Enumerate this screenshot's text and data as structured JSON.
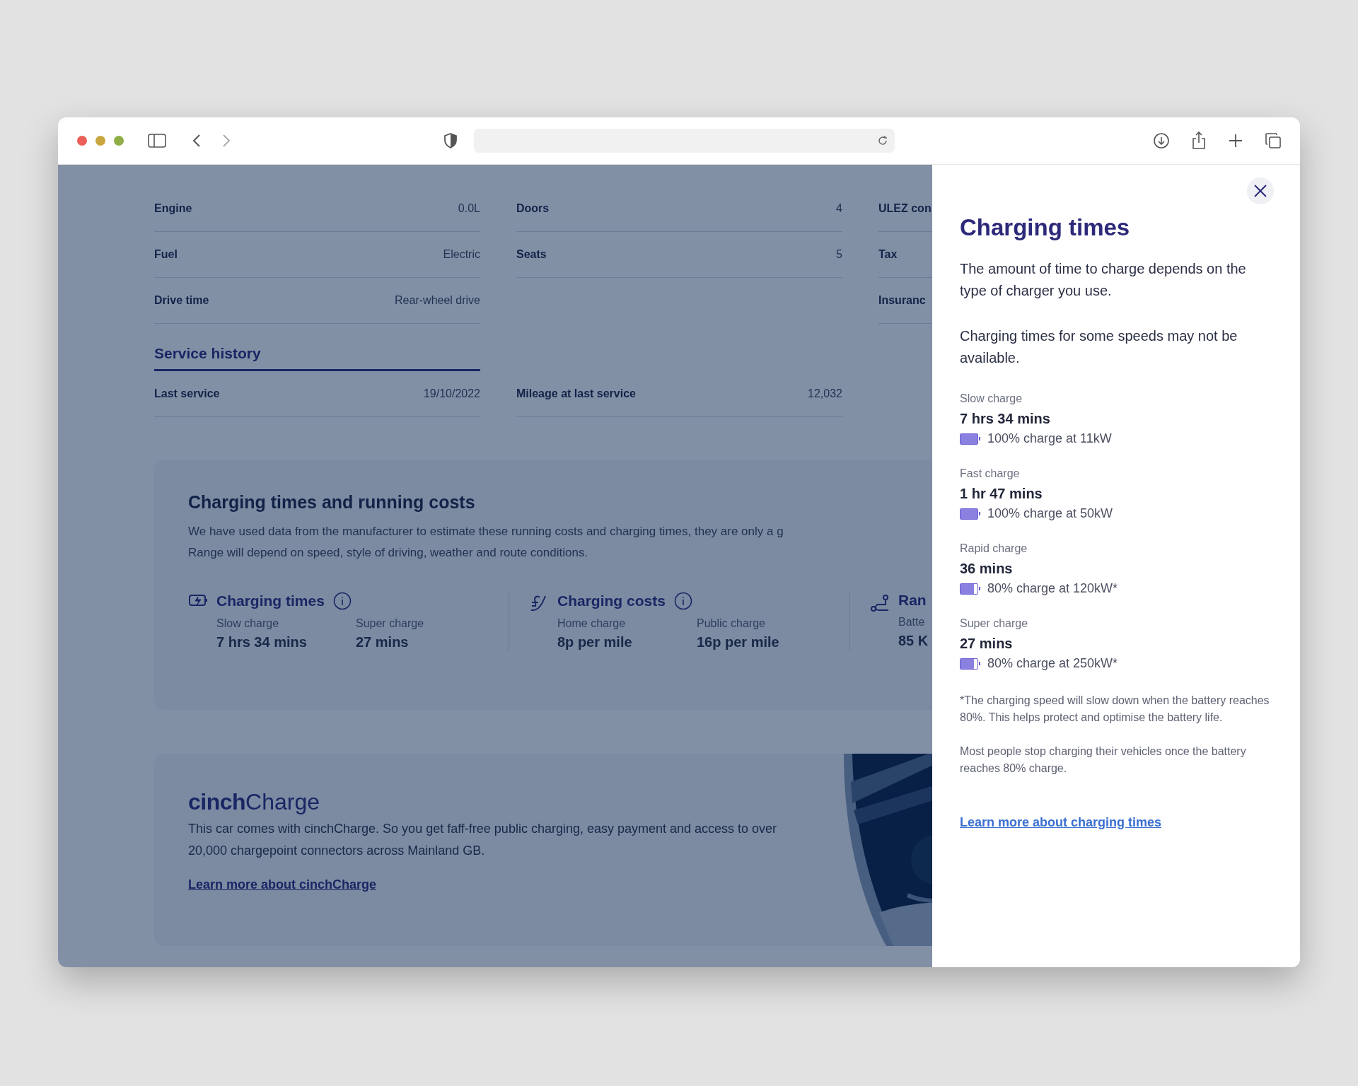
{
  "specs": {
    "columns": [
      [
        {
          "label": "Engine",
          "value": "0.0L"
        },
        {
          "label": "Fuel",
          "value": "Electric"
        },
        {
          "label": "Drive time",
          "value": "Rear-wheel drive"
        }
      ],
      [
        {
          "label": "Doors",
          "value": "4"
        },
        {
          "label": "Seats",
          "value": "5"
        }
      ],
      [
        {
          "label": "ULEZ con"
        },
        {
          "label": "Tax"
        },
        {
          "label": "Insuranc"
        }
      ]
    ]
  },
  "service_history": {
    "title": "Service history",
    "rows": [
      {
        "label": "Last service",
        "value": "19/10/2022"
      },
      {
        "label": "Mileage at last service",
        "value": "12,032"
      }
    ]
  },
  "running_costs": {
    "title": "Charging times and running costs",
    "description_lines": [
      "We have used data from the manufacturer to estimate these running costs and charging times, they are only a g",
      "Range will depend on speed, style of driving, weather and route conditions."
    ],
    "stats": [
      {
        "kind": "charging",
        "title": "Charging times",
        "info": true,
        "items": [
          {
            "label": "Slow charge",
            "value": "7 hrs 34 mins"
          },
          {
            "label": "Super charge",
            "value": "27 mins"
          }
        ]
      },
      {
        "kind": "cost",
        "title": "Charging costs",
        "info": true,
        "items": [
          {
            "label": "Home charge",
            "value": "8p per mile"
          },
          {
            "label": "Public charge",
            "value": "16p per mile"
          }
        ]
      },
      {
        "kind": "range",
        "title": "Ran",
        "info": false,
        "items": [
          {
            "label": "Batte",
            "value": "85 K"
          }
        ]
      }
    ]
  },
  "cinch_charge": {
    "logo_bold": "cinch",
    "logo_light": "Charge",
    "text": "This car comes with cinchCharge. So you get faff-free public charging, easy payment and access to over 20,000 chargepoint connectors across Mainland GB.",
    "link": "Learn more about cinchCharge"
  },
  "drawer": {
    "title": "Charging times",
    "paragraphs": [
      "The amount of time to charge depends on the type of charger you use.",
      "Charging times for some speeds may not be available."
    ],
    "speeds": [
      {
        "label": "Slow charge",
        "time": "7 hrs 34 mins",
        "detail": "100% charge at 11kW",
        "level": 1
      },
      {
        "label": "Fast charge",
        "time": "1 hr 47 mins",
        "detail": "100% charge at 50kW",
        "level": 1
      },
      {
        "label": "Rapid charge",
        "time": "36 mins",
        "detail": "80% charge at 120kW*",
        "level": 0.8
      },
      {
        "label": "Super charge",
        "time": "27 mins",
        "detail": "80% charge at 250kW*",
        "level": 0.8
      }
    ],
    "notes": [
      "*The charging speed will slow down when the battery reaches 80%. This helps protect and optimise the battery life.",
      "Most people stop charging their vehicles once the battery reaches 80% charge."
    ],
    "link": "Learn more about charging times"
  }
}
